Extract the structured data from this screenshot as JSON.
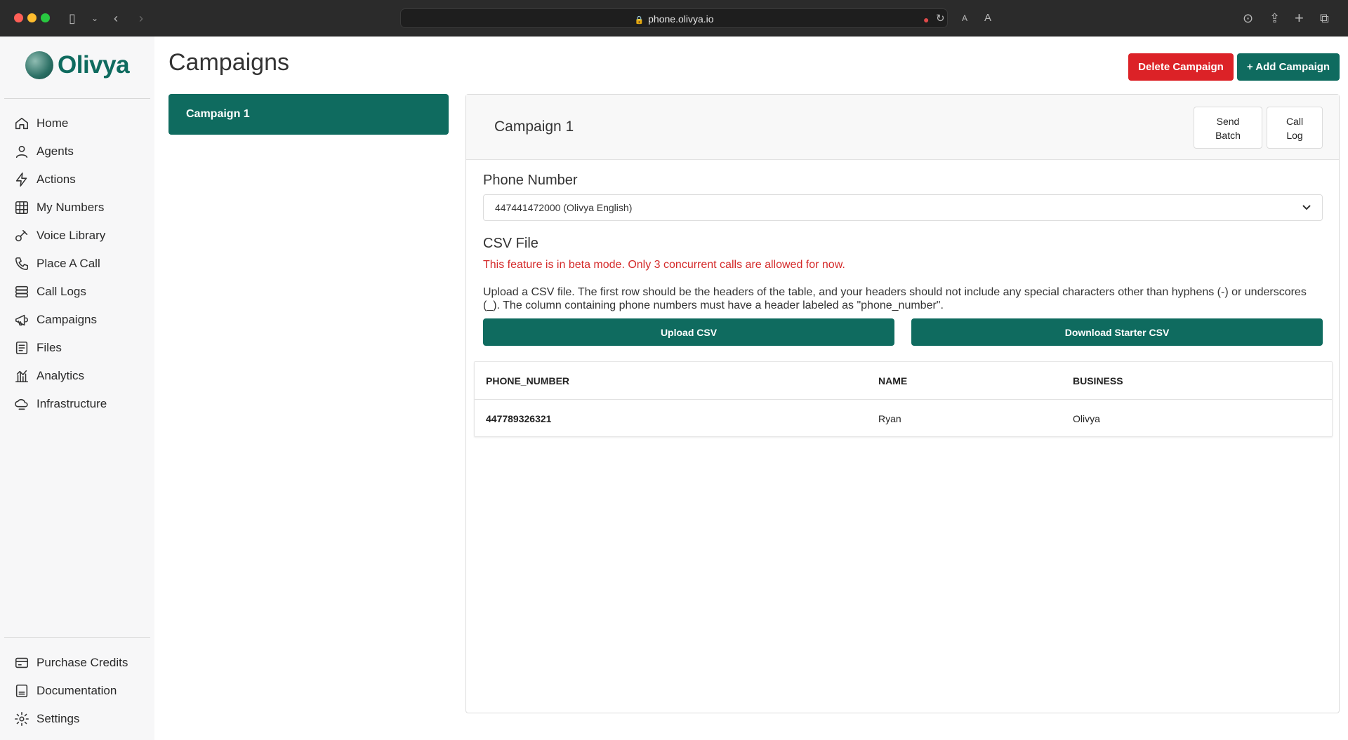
{
  "browser": {
    "url": "phone.olivya.io"
  },
  "sidebar": {
    "logo_text": "Olivya",
    "items": [
      {
        "label": "Home",
        "icon": "home-icon"
      },
      {
        "label": "Agents",
        "icon": "user-icon"
      },
      {
        "label": "Actions",
        "icon": "lightning-icon"
      },
      {
        "label": "My Numbers",
        "icon": "grid-icon"
      },
      {
        "label": "Voice Library",
        "icon": "voice-icon"
      },
      {
        "label": "Place A Call",
        "icon": "phone-icon"
      },
      {
        "label": "Call Logs",
        "icon": "database-icon"
      },
      {
        "label": "Campaigns",
        "icon": "megaphone-icon"
      },
      {
        "label": "Files",
        "icon": "file-icon"
      },
      {
        "label": "Analytics",
        "icon": "chart-icon"
      },
      {
        "label": "Infrastructure",
        "icon": "cloud-icon"
      }
    ],
    "bottom_items": [
      {
        "label": "Purchase Credits",
        "icon": "credit-card-icon"
      },
      {
        "label": "Documentation",
        "icon": "document-icon"
      },
      {
        "label": "Settings",
        "icon": "gear-icon"
      }
    ]
  },
  "header": {
    "title": "Campaigns",
    "delete_label": "Delete Campaign",
    "add_label": "+ Add Campaign"
  },
  "campaigns": [
    {
      "name": "Campaign 1",
      "selected": true
    }
  ],
  "panel": {
    "title": "Campaign 1",
    "send_batch_line1": "Send",
    "send_batch_line2": "Batch",
    "call_log_line1": "Call",
    "call_log_line2": "Log",
    "phone_number_label": "Phone Number",
    "phone_number_value": "447441472000 (Olivya English)",
    "csv_label": "CSV File",
    "warning": "This feature is in beta mode. Only 3 concurrent calls are allowed for now.",
    "description": "Upload a CSV file. The first row should be the headers of the table, and your headers should not include any special characters other than hyphens (-) or underscores (_). The column containing phone numbers must have a header labeled as \"phone_number\".",
    "upload_label": "Upload CSV",
    "download_label": "Download Starter CSV",
    "table": {
      "headers": [
        "PHONE_NUMBER",
        "NAME",
        "BUSINESS"
      ],
      "rows": [
        [
          "447789326321",
          "Ryan",
          "Olivya"
        ]
      ]
    }
  },
  "colors": {
    "brand": "#0f6b5f",
    "danger": "#dc2227"
  }
}
